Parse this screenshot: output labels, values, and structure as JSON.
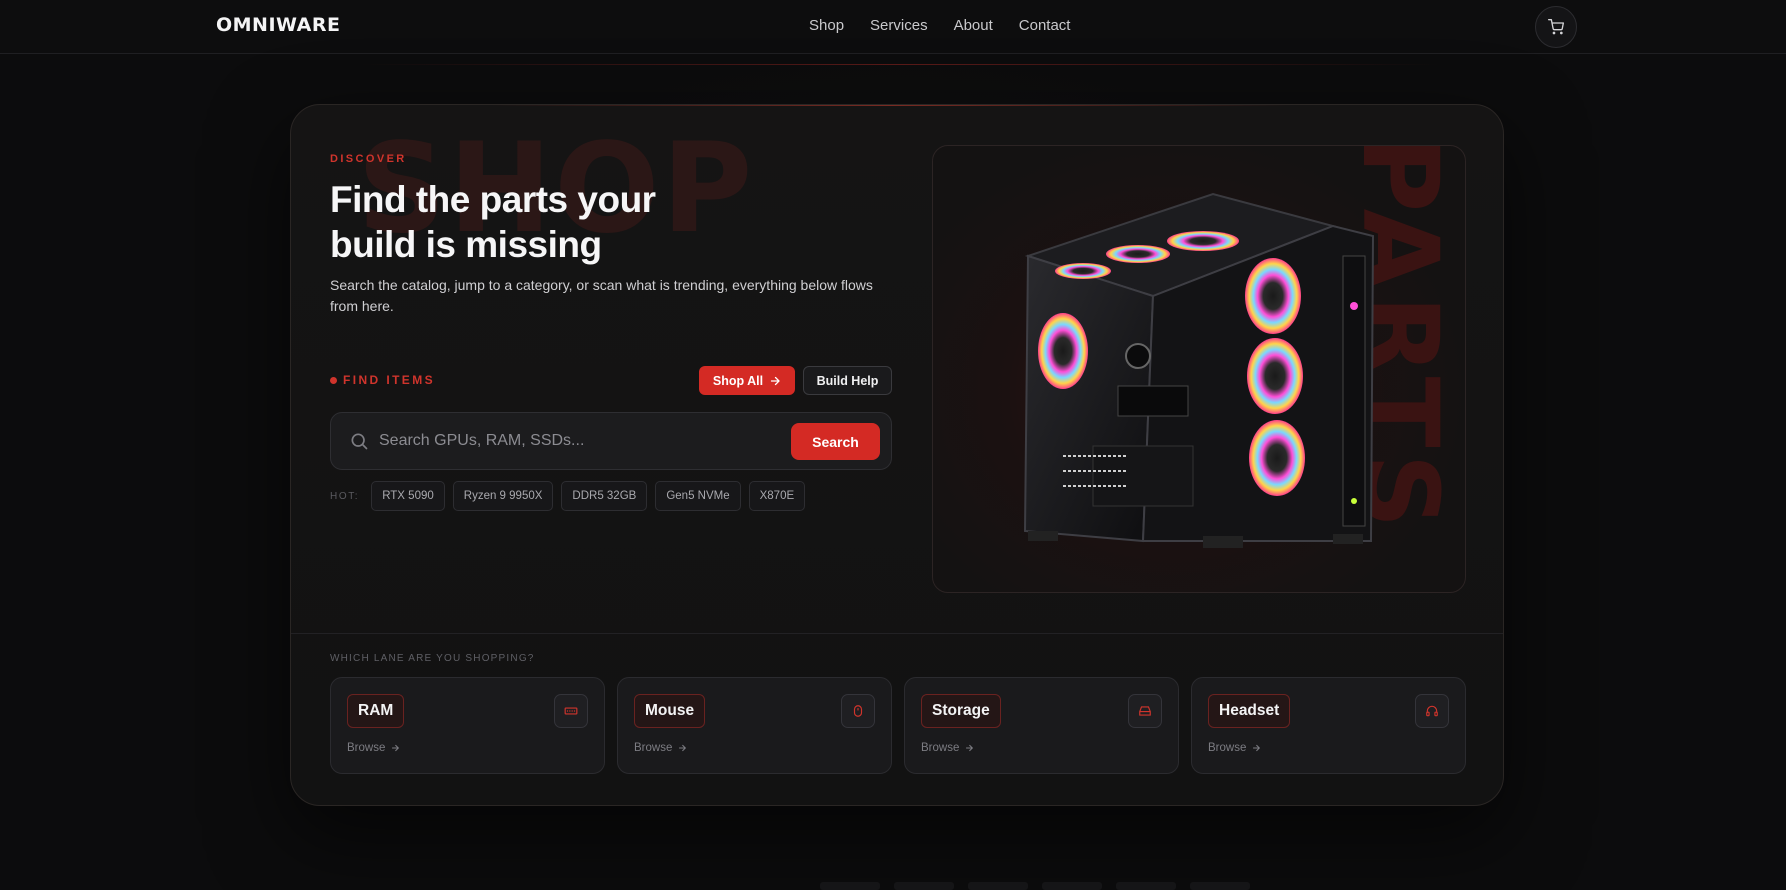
{
  "nav": {
    "logo": "OMNIWARE",
    "links": [
      "Shop",
      "Services",
      "About",
      "Contact"
    ],
    "cart_icon": "cart-icon"
  },
  "hero": {
    "ghost_word": "SHOP",
    "eyebrow": "DISCOVER",
    "headline": "Find the parts your build is missing",
    "subtext": "Search the catalog, jump to a category, or scan what is trending, everything below flows from here.",
    "find_label": "FIND ITEMS",
    "shop_all_label": "Shop All",
    "build_help_label": "Build Help",
    "search": {
      "placeholder": "Search GPUs, RAM, SSDs...",
      "value": "",
      "button_label": "Search"
    },
    "hot": {
      "label": "HOT:",
      "chips": [
        "RTX 5090",
        "Ryzen 9 9950X",
        "DDR5 32GB",
        "Gen5 NVMe",
        "X870E"
      ]
    },
    "product_ghost_word": "PARTS"
  },
  "lanes": {
    "label": "WHICH LANE ARE YOU SHOPPING?",
    "items": [
      {
        "title": "RAM",
        "icon": "memory-icon",
        "browse": "Browse"
      },
      {
        "title": "Mouse",
        "icon": "mouse-icon",
        "browse": "Browse"
      },
      {
        "title": "Storage",
        "icon": "drive-icon",
        "browse": "Browse"
      },
      {
        "title": "Headset",
        "icon": "headset-icon",
        "browse": "Browse"
      }
    ]
  },
  "colors": {
    "accent": "#d42a24",
    "background": "#0c0c0d",
    "card": "#1a1a1c"
  }
}
